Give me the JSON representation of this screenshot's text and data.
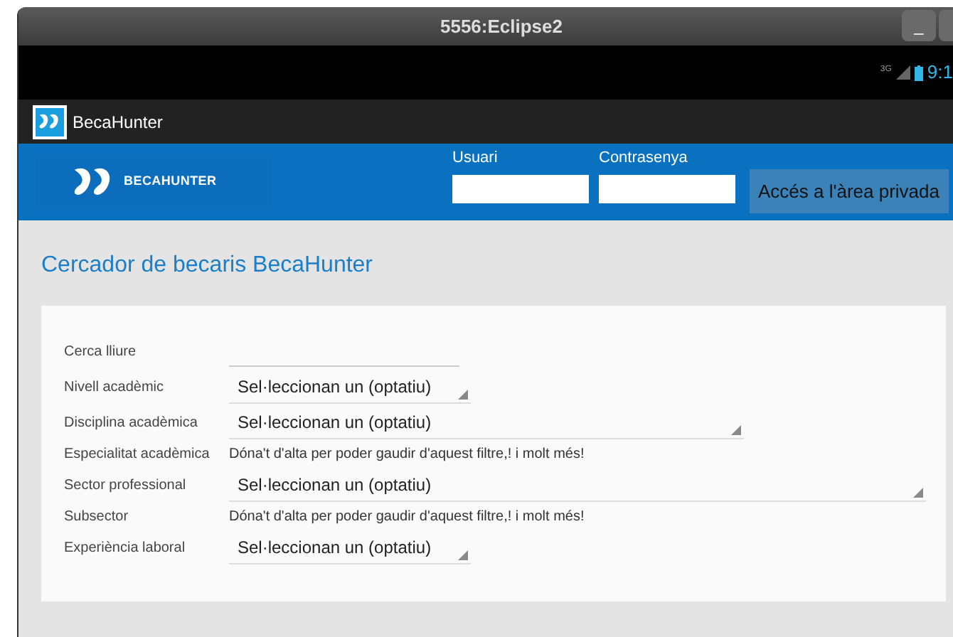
{
  "window": {
    "title": "5556:Eclipse2",
    "minimize": "_"
  },
  "status_bar": {
    "network": "3G",
    "time": "9:1"
  },
  "action_bar": {
    "title": "BecaHunter"
  },
  "header": {
    "brand_bold": "BECA",
    "brand_rest": "HUNTER",
    "user_label": "Usuari",
    "password_label": "Contrasenya",
    "login_button": "Accés a l'àrea privada"
  },
  "search": {
    "title": "Cercador de becaris BecaHunter",
    "fields": [
      {
        "kind": "input",
        "label": "Cerca lliure"
      },
      {
        "kind": "select",
        "label": "Nivell acadèmic",
        "value": "Sel·leccionan un (optatiu)"
      },
      {
        "kind": "select",
        "label": "Disciplina acadèmica",
        "value": "Sel·leccionan un (optatiu)"
      },
      {
        "kind": "notice",
        "label": "Especialitat acadèmica",
        "value": "Dóna't d'alta per poder gaudir d'aquest filtre,! i molt més!"
      },
      {
        "kind": "select",
        "label": "Sector professional",
        "value": "Sel·leccionan un (optatiu)"
      },
      {
        "kind": "notice",
        "label": "Subsector",
        "value": "Dóna't d'alta per poder gaudir d'aquest filtre,! i molt més!"
      },
      {
        "kind": "select",
        "label": "Experiència laboral",
        "value": "Sel·leccionan un (optatiu)"
      }
    ]
  }
}
